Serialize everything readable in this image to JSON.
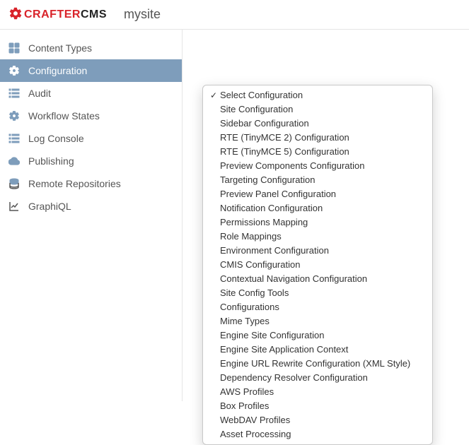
{
  "header": {
    "logo_red": "CRAFTER",
    "logo_black": "CMS",
    "site_name": "mysite"
  },
  "sidebar": {
    "items": [
      {
        "label": "Content Types",
        "icon": "grid-icon",
        "active": false
      },
      {
        "label": "Configuration",
        "icon": "gear-icon",
        "active": true
      },
      {
        "label": "Audit",
        "icon": "list-icon",
        "active": false
      },
      {
        "label": "Workflow States",
        "icon": "gear-icon",
        "active": false
      },
      {
        "label": "Log Console",
        "icon": "list-icon",
        "active": false
      },
      {
        "label": "Publishing",
        "icon": "cloud-icon",
        "active": false
      },
      {
        "label": "Remote Repositories",
        "icon": "database-icon",
        "active": false
      },
      {
        "label": "GraphiQL",
        "icon": "chart-icon",
        "active": false
      }
    ]
  },
  "dropdown": {
    "selected_index": 0,
    "options": [
      "Select Configuration",
      "Site Configuration",
      "Sidebar Configuration",
      "RTE (TinyMCE 2) Configuration",
      "RTE (TinyMCE 5) Configuration",
      "Preview Components Configuration",
      "Targeting Configuration",
      "Preview Panel Configuration",
      "Notification Configuration",
      "Permissions Mapping",
      "Role Mappings",
      "Environment Configuration",
      "CMIS Configuration",
      "Contextual Navigation Configuration",
      "Site Config Tools",
      "Configurations",
      "Mime Types",
      "Engine Site Configuration",
      "Engine Site Application Context",
      "Engine URL Rewrite Configuration (XML Style)",
      "Dependency Resolver Configuration",
      "AWS Profiles",
      "Box Profiles",
      "WebDAV Profiles",
      "Asset Processing"
    ]
  }
}
